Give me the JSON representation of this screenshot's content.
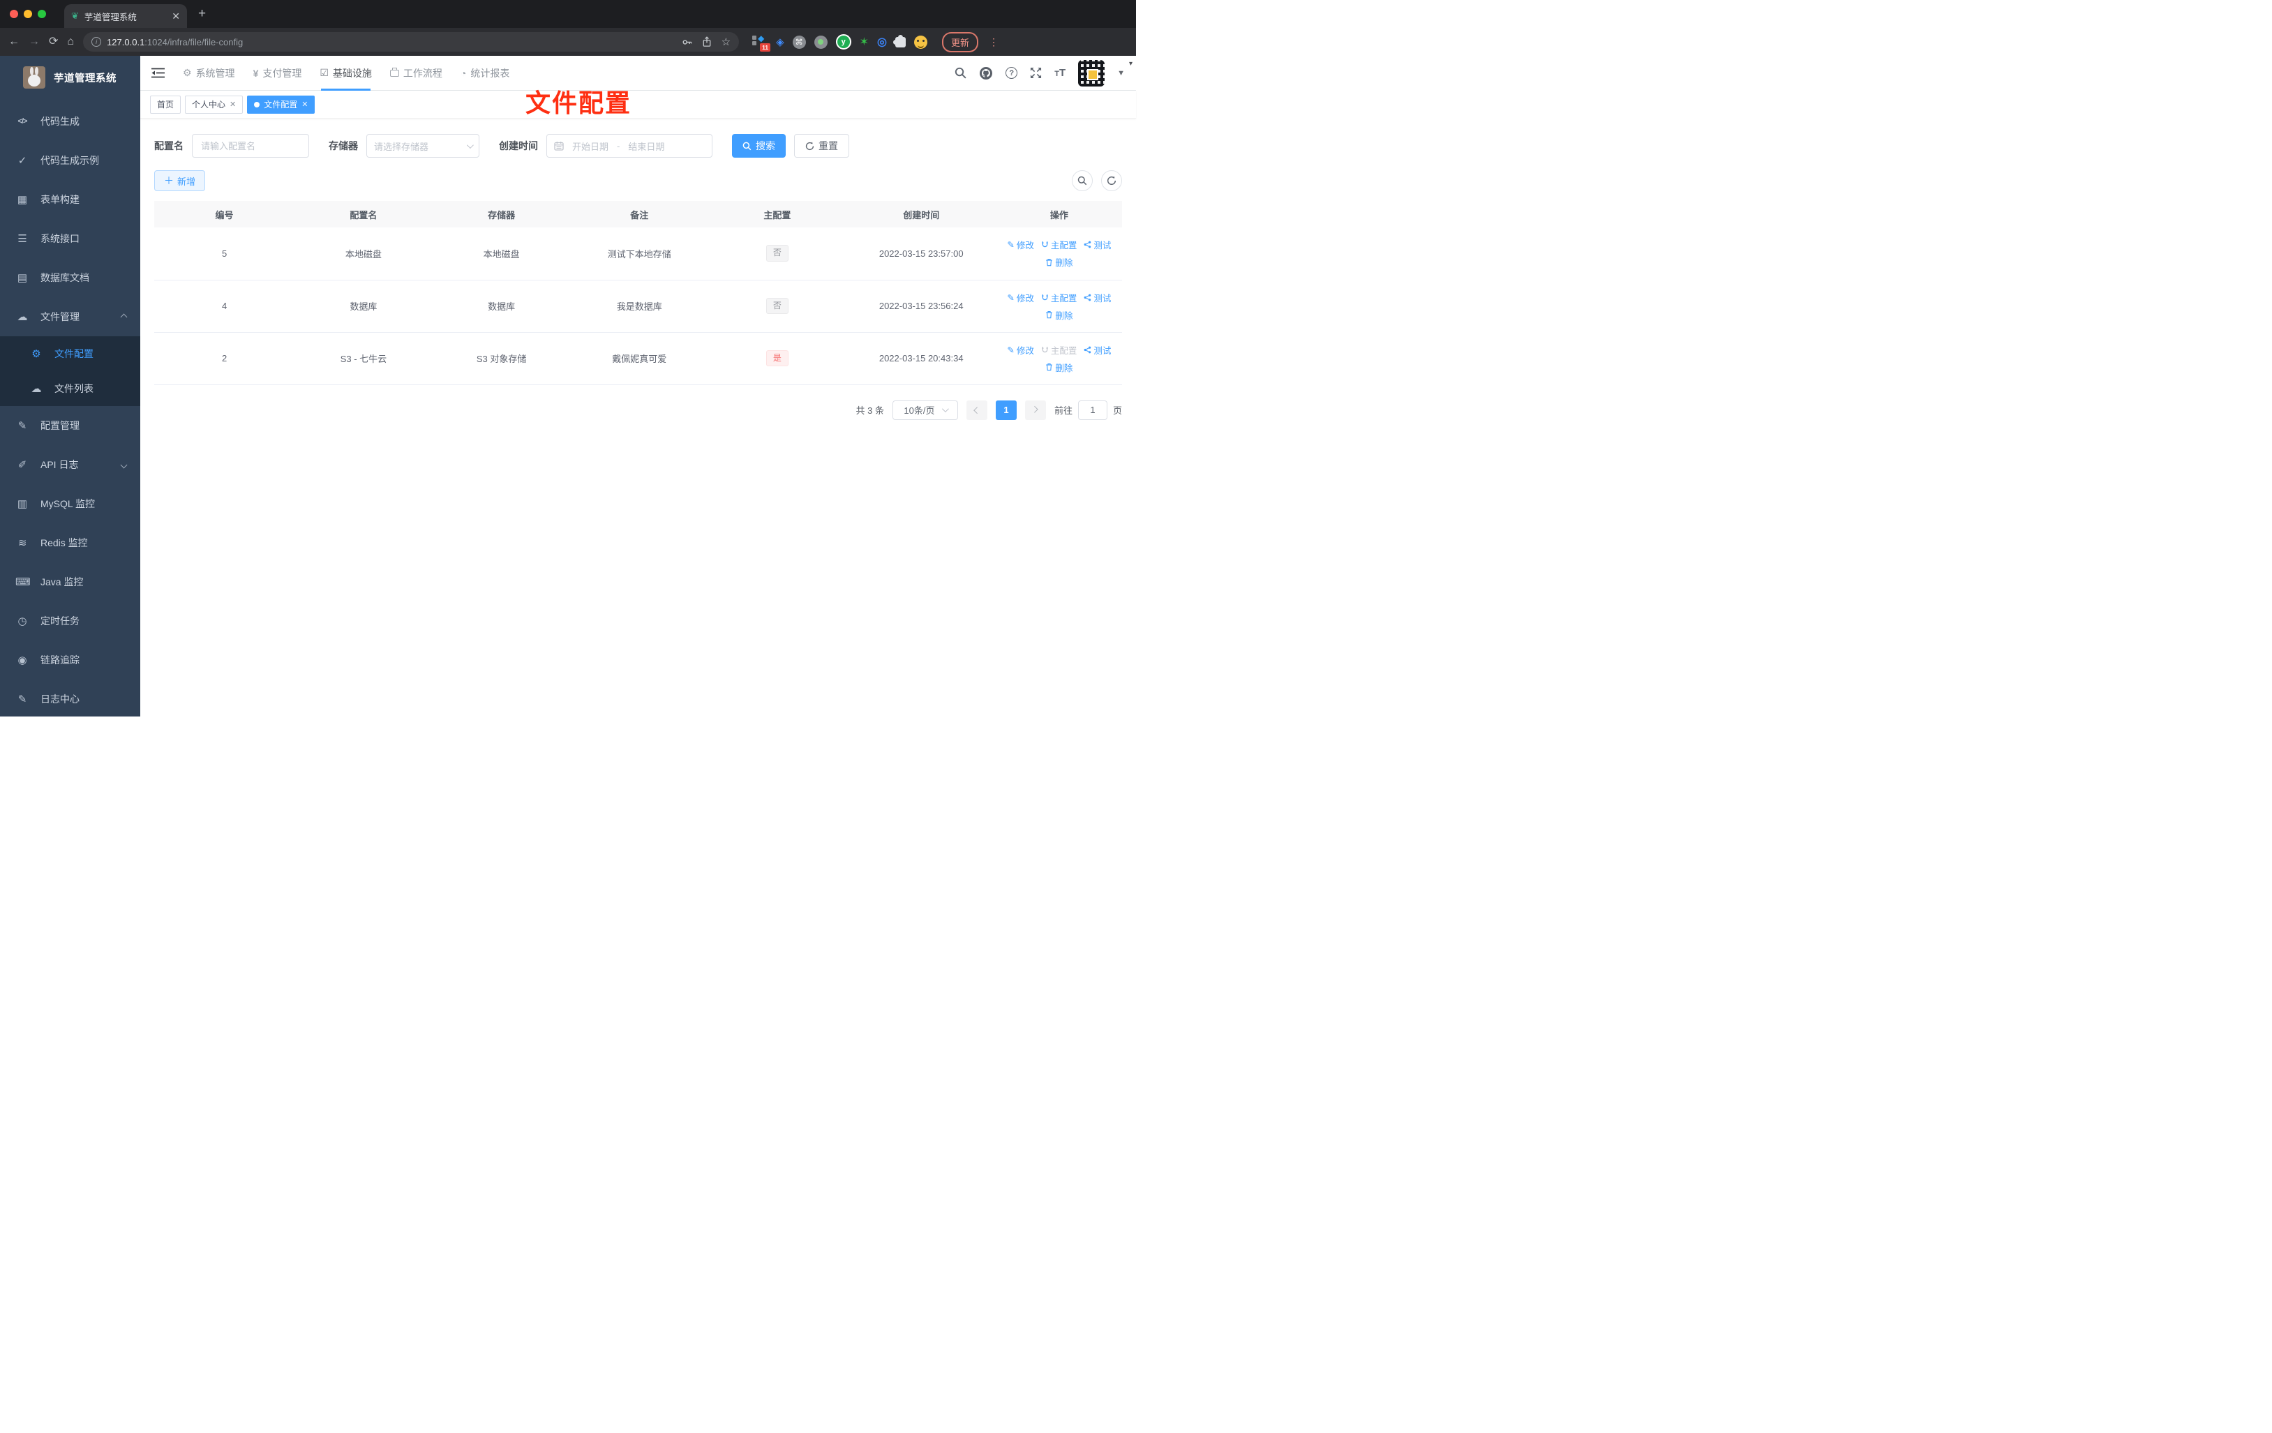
{
  "colors": {
    "accent": "#409eff",
    "danger": "#f56c6c",
    "sidebar_bg": "#304156",
    "annotation_red": "#fe2f12"
  },
  "browser": {
    "tab_title": "芋道管理系统",
    "url_host": "127.0.0.1",
    "url_rest": ":1024/infra/file/file-config",
    "extension_badge": "11",
    "update_label": "更新",
    "toolbar_icons": [
      "back-icon",
      "forward-icon",
      "reload-icon",
      "home-icon",
      "key-icon",
      "share-icon",
      "star-icon",
      "extensions",
      "profile",
      "menu-kebab-icon"
    ]
  },
  "sidebar": {
    "title": "芋道管理系统",
    "items": [
      {
        "icon": "code-icon",
        "label": "代码生成"
      },
      {
        "icon": "shield-check-icon",
        "label": "代码生成示例"
      },
      {
        "icon": "form-grid-icon",
        "label": "表单构建"
      },
      {
        "icon": "sliders-icon",
        "label": "系统接口"
      },
      {
        "icon": "table-icon",
        "label": "数据库文档"
      },
      {
        "icon": "cloud-download-icon",
        "label": "文件管理",
        "state": "expanded"
      },
      {
        "icon": "gear-icon",
        "label": "文件配置",
        "state": "active-sub"
      },
      {
        "icon": "cloud-upload-icon",
        "label": "文件列表",
        "state": "sub"
      },
      {
        "icon": "edit-square-icon",
        "label": "配置管理"
      },
      {
        "icon": "api-log-icon",
        "label": "API 日志",
        "state": "collapsed"
      },
      {
        "icon": "mysql-monitor-icon",
        "label": "MySQL 监控"
      },
      {
        "icon": "redis-layers-icon",
        "label": "Redis 监控"
      },
      {
        "icon": "java-monitor-icon",
        "label": "Java 监控"
      },
      {
        "icon": "timer-icon",
        "label": "定时任务"
      },
      {
        "icon": "eye-icon",
        "label": "链路追踪"
      },
      {
        "icon": "log-center-icon",
        "label": "日志中心"
      }
    ]
  },
  "navbar": {
    "items": [
      {
        "icon": "gear-icon",
        "label": "系统管理"
      },
      {
        "icon": "yen-icon",
        "label": "支付管理"
      },
      {
        "icon": "infra-monitor-icon",
        "label": "基础设施",
        "active": true
      },
      {
        "icon": "briefcase-icon",
        "label": "工作流程"
      },
      {
        "icon": "dashboard-icon",
        "label": "统计报表"
      }
    ],
    "right_icons": [
      "search-icon",
      "github-icon",
      "help-icon",
      "fullscreen-icon",
      "font-size-icon",
      "avatar-qr",
      "caret-down-icon"
    ]
  },
  "tags": {
    "home": "首页",
    "profile": "个人中心",
    "current": "文件配置"
  },
  "annotation": {
    "text": "文件配置"
  },
  "filters": {
    "name_label": "配置名",
    "name_placeholder": "请输入配置名",
    "storage_label": "存储器",
    "storage_placeholder": "请选择存储器",
    "time_label": "创建时间",
    "start_placeholder": "开始日期",
    "range_separator": "-",
    "end_placeholder": "结束日期",
    "search_label": "搜索",
    "reset_label": "重置"
  },
  "toolbar": {
    "add_label": "新增"
  },
  "table": {
    "headers": [
      "编号",
      "配置名",
      "存储器",
      "备注",
      "主配置",
      "创建时间",
      "操作"
    ],
    "actions": {
      "edit": "修改",
      "master": "主配置",
      "test": "测试",
      "delete": "删除"
    },
    "rows": [
      {
        "id": "5",
        "name": "本地磁盘",
        "storage": "本地磁盘",
        "remark": "测试下本地存储",
        "primary": "否",
        "created": "2022-03-15 23:57:00"
      },
      {
        "id": "4",
        "name": "数据库",
        "storage": "数据库",
        "remark": "我是数据库",
        "primary": "否",
        "created": "2022-03-15 23:56:24"
      },
      {
        "id": "2",
        "name": "S3 - 七牛云",
        "storage": "S3 对象存储",
        "remark": "戴佩妮真可爱",
        "primary": "是",
        "created": "2022-03-15 20:43:34"
      }
    ]
  },
  "pagination": {
    "total": "共 3 条",
    "page_size": "10条/页",
    "current_page": "1",
    "goto_label": "前往",
    "goto_value": "1",
    "goto_unit": "页"
  }
}
